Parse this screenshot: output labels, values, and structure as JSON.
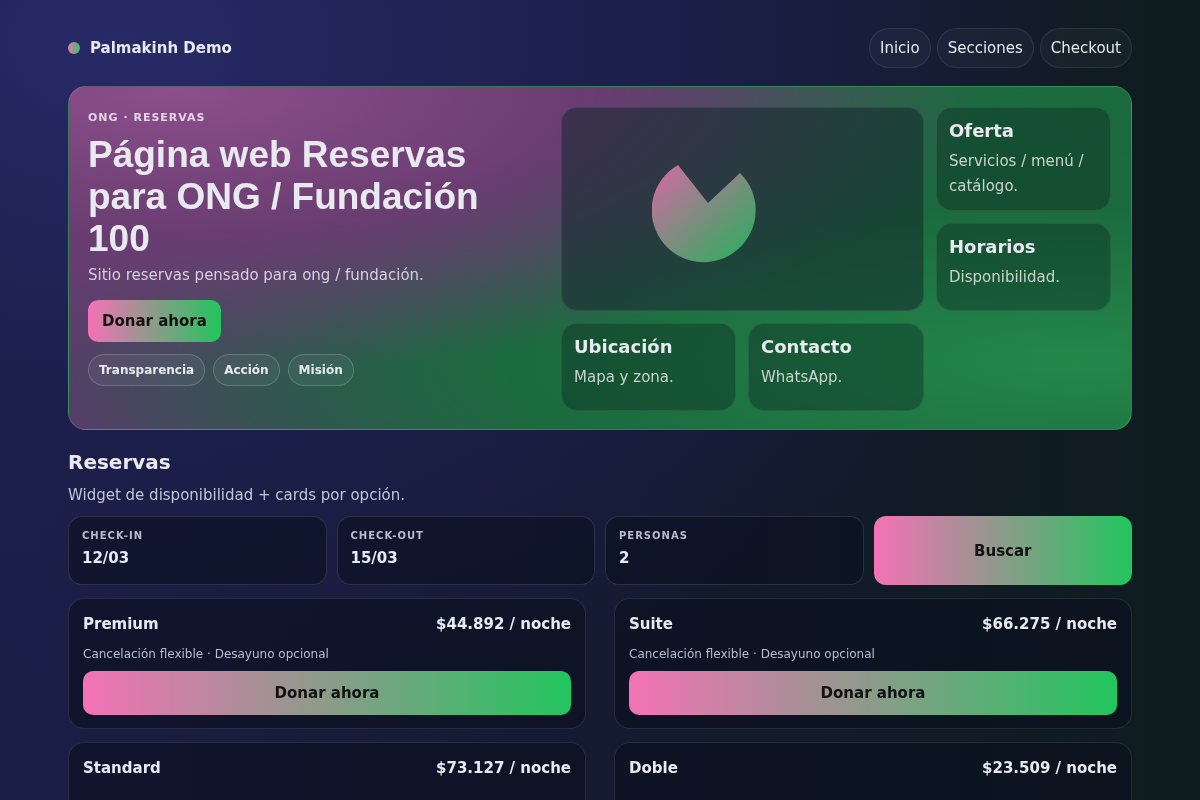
{
  "brand": {
    "name": "Palmakinh Demo"
  },
  "nav": [
    {
      "label": "Inicio"
    },
    {
      "label": "Secciones"
    },
    {
      "label": "Checkout"
    }
  ],
  "hero": {
    "eyebrow": "ONG · RESERVAS",
    "title": "Página web Reservas para ONG / Fundación 100",
    "subtitle": "Sitio reservas pensado para ong / fundación.",
    "cta": "Donar ahora",
    "tags": [
      "Transparencia",
      "Acción",
      "Misión"
    ],
    "tiles": [
      {
        "title": "Oferta",
        "text": "Servicios / menú / catálogo."
      },
      {
        "title": "Horarios",
        "text": "Disponibilidad."
      },
      {
        "title": "Ubicación",
        "text": "Mapa y zona."
      },
      {
        "title": "Contacto",
        "text": "WhatsApp."
      }
    ]
  },
  "section": {
    "title": "Reservas",
    "subtitle": "Widget de disponibilidad + cards por opción."
  },
  "search": {
    "fields": [
      {
        "label": "CHECK-IN",
        "value": "12/03"
      },
      {
        "label": "CHECK-OUT",
        "value": "15/03"
      },
      {
        "label": "PERSONAS",
        "value": "2"
      }
    ],
    "button": "Buscar"
  },
  "options": [
    {
      "name": "Premium",
      "price": "$44.892 / noche",
      "details": "Cancelación flexible · Desayuno opcional",
      "button": "Donar ahora"
    },
    {
      "name": "Suite",
      "price": "$66.275 / noche",
      "details": "Cancelación flexible · Desayuno opcional",
      "button": "Donar ahora"
    },
    {
      "name": "Standard",
      "price": "$73.127 / noche"
    },
    {
      "name": "Doble",
      "price": "$23.509 / noche"
    }
  ]
}
